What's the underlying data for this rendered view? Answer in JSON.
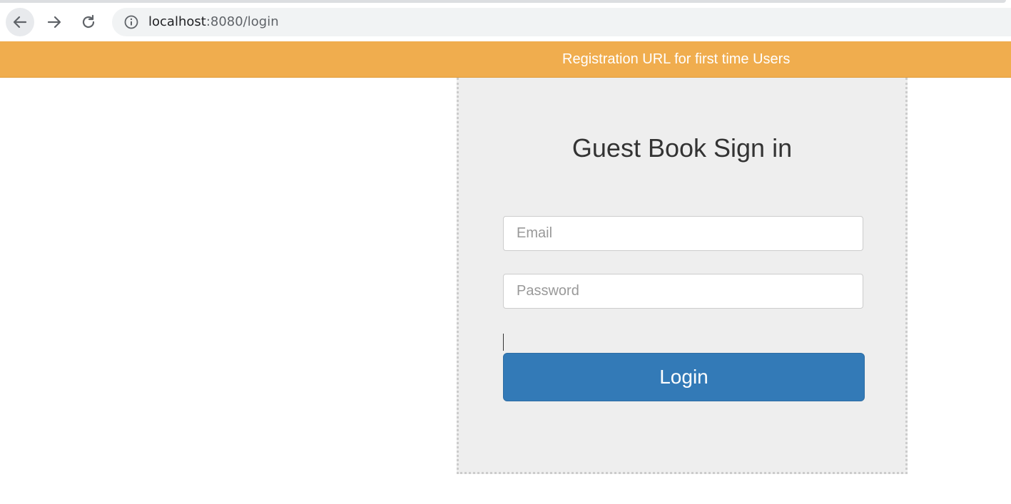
{
  "browser": {
    "url_host": "localhost",
    "url_rest": ":8080/login",
    "icons": {
      "back": "arrow-left-icon",
      "forward": "arrow-right-icon",
      "reload": "reload-icon",
      "info": "info-icon"
    }
  },
  "topbar": {
    "registration_link": "Registration URL for first time Users",
    "color": "#f0ad4e"
  },
  "login": {
    "title": "Guest Book Sign in",
    "email_placeholder": "Email",
    "password_placeholder": "Password",
    "button_label": "Login",
    "button_color": "#337ab7"
  }
}
